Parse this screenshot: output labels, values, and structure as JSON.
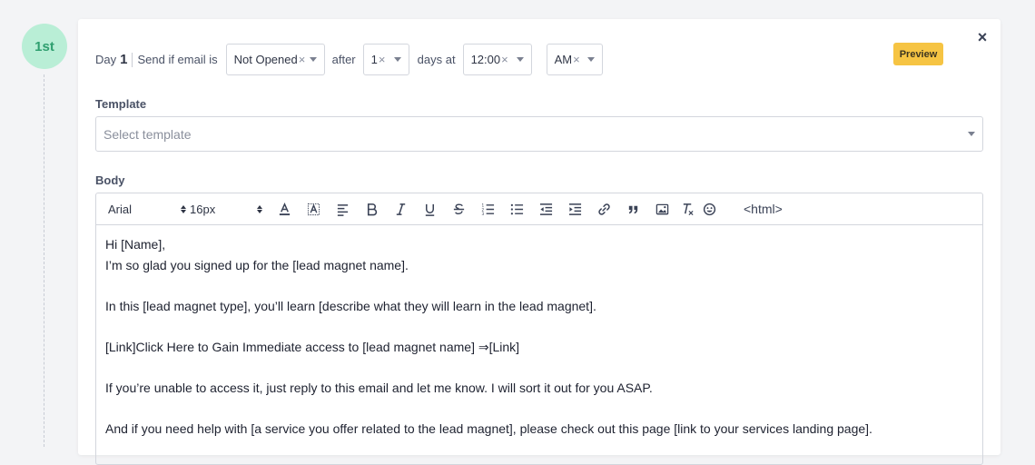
{
  "step": {
    "label": "1st"
  },
  "condition": {
    "day_label": "Day",
    "day_number": "1",
    "send_if_text": "Send if email is",
    "status_value": "Not Opened",
    "after_text": "after",
    "days_value": "1",
    "days_at_text": "days at",
    "time_value": "12:00",
    "ampm_value": "AM"
  },
  "preview_label": "Preview",
  "close_label": "×",
  "template": {
    "label": "Template",
    "placeholder": "Select template"
  },
  "body": {
    "label": "Body",
    "font_value": "Arial",
    "size_value": "16px",
    "html_label": "<html>",
    "lines": [
      "Hi [Name],",
      "I’m so glad you signed up for the [lead magnet name].",
      "",
      "In this [lead magnet type], you’ll learn [describe what they will learn in the lead magnet].",
      "",
      "[Link]Click Here to Gain Immediate access to [lead magnet name] ⇒[Link]",
      "",
      "If you’re unable to access it, just reply to this email and let me know. I will sort it out for you ASAP.",
      "",
      "And if you need help with [a service you offer related to the lead magnet], please check out this page [link to your services landing page]."
    ]
  },
  "colors": {
    "accent_green": "#b9eed6",
    "preview_yellow": "#f6c443",
    "border": "#d3d6dd"
  }
}
